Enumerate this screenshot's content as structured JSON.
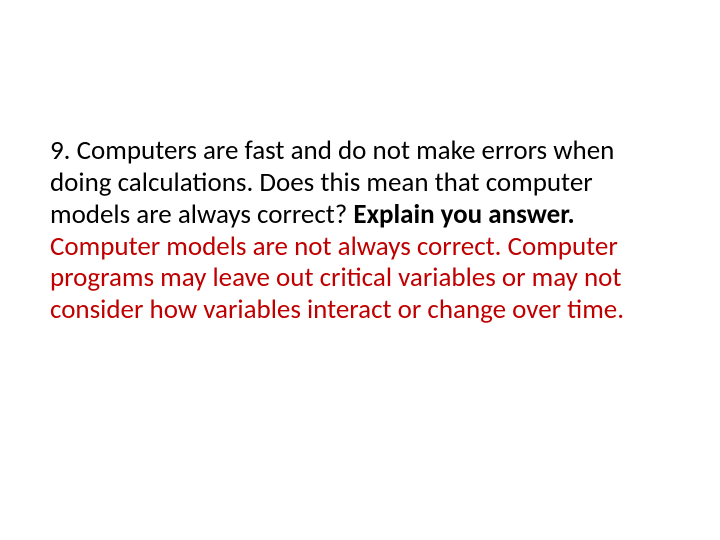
{
  "slide": {
    "question_number": "9.",
    "question_part1": "Computers are fast and do not make errors when doing calculations.  Does this mean that computer models are always correct?  ",
    "question_bold": "Explain you answer.",
    "answer": "Computer models are not always correct. Computer programs may leave out critical variables or may not consider how variables interact or change over time."
  }
}
